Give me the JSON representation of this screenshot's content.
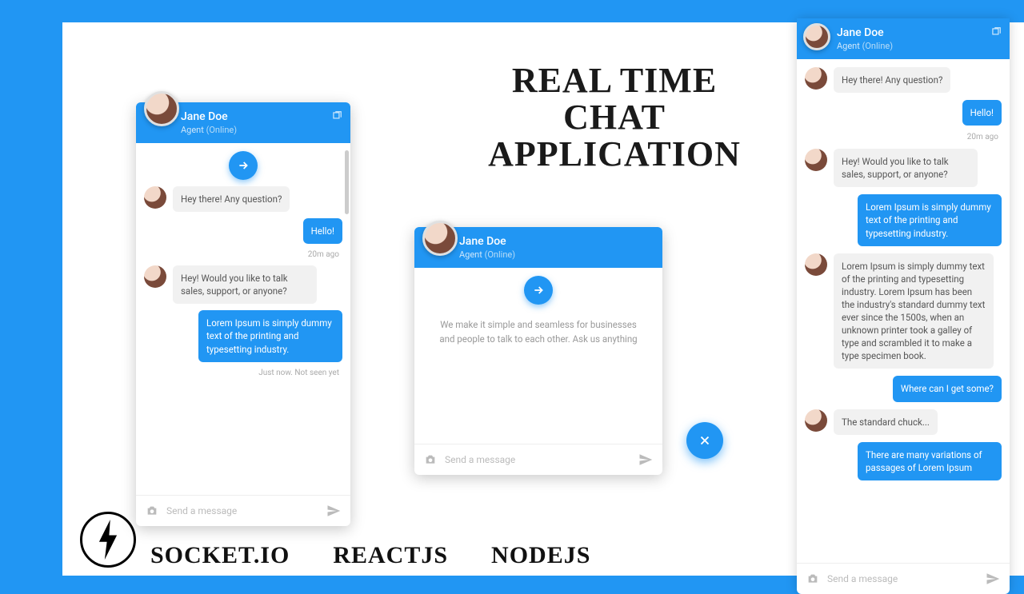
{
  "title_lines": [
    "REAL TIME",
    "CHAT",
    "APPLICATION"
  ],
  "techs": [
    "SOCKET.IO",
    "REACTJS",
    "NODEJS"
  ],
  "agent": {
    "name": "Jane Doe",
    "role": "Agent",
    "status": "(Online)"
  },
  "input": {
    "placeholder": "Send a message"
  },
  "chat_left": {
    "messages": [
      {
        "side": "left",
        "text": "Hey there! Any question?"
      },
      {
        "side": "right",
        "text": "Hello!",
        "meta": "20m ago"
      },
      {
        "side": "left",
        "text": "Hey! Would you like to talk sales, support, or anyone?"
      },
      {
        "side": "right",
        "text": "Lorem Ipsum is simply dummy text of the printing and typesetting industry.",
        "meta": "Just now. Not seen yet"
      }
    ]
  },
  "chat_center": {
    "welcome": "We make it simple and seamless for businesses and people to talk to each other. Ask us anything"
  },
  "chat_right": {
    "messages": [
      {
        "side": "left",
        "text": "Hey there! Any question?"
      },
      {
        "side": "right",
        "text": "Hello!",
        "meta": "20m ago"
      },
      {
        "side": "left",
        "text": "Hey! Would you like to talk sales, support, or anyone?"
      },
      {
        "side": "right",
        "text": "Lorem Ipsum is simply dummy text of the printing and typesetting industry."
      },
      {
        "side": "left",
        "text": "Lorem Ipsum is simply dummy text of the printing and typesetting industry. Lorem Ipsum has been the industry's standard dummy text ever since the 1500s, when an unknown printer took a galley of type and scrambled it to make a type specimen book."
      },
      {
        "side": "right",
        "text": "Where can I get some?"
      },
      {
        "side": "left",
        "text": "The standard chuck..."
      },
      {
        "side": "right",
        "text": "There are many variations of passages of Lorem Ipsum"
      }
    ]
  }
}
